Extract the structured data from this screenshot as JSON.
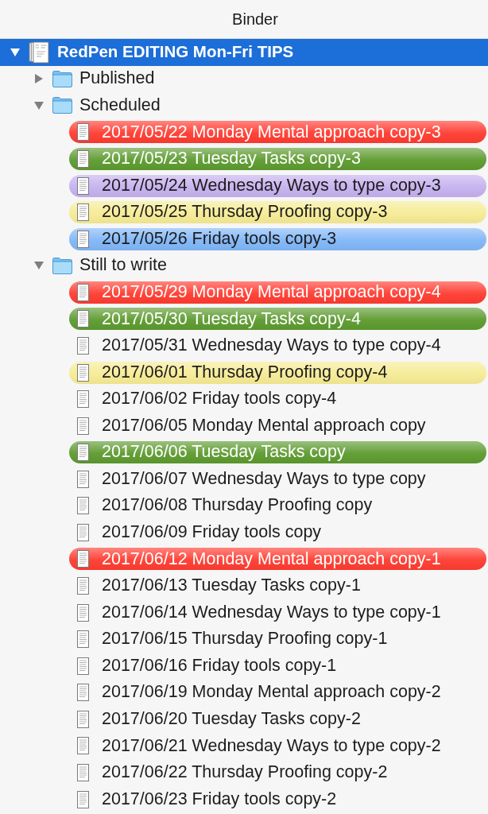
{
  "panel": {
    "title": "Binder"
  },
  "tree": [
    {
      "label": "RedPen EDITING Mon-Fri TIPS",
      "kind": "project",
      "selected": true,
      "expanded": true,
      "children": [
        {
          "label": "Published",
          "kind": "folder",
          "selected": false,
          "expanded": false
        },
        {
          "label": "Scheduled",
          "kind": "folder",
          "selected": false,
          "expanded": true,
          "children": [
            {
              "label": "2017/05/22 Monday Mental approach copy-3",
              "kind": "document",
              "selected": false,
              "color": "#ff3b30"
            },
            {
              "label": "2017/05/23 Tuesday Tasks copy-3",
              "kind": "document",
              "selected": false,
              "color": "#5c9a2e"
            },
            {
              "label": "2017/05/24 Wednesday Ways to type copy-3",
              "kind": "document",
              "selected": false,
              "color": "#c5b0ee"
            },
            {
              "label": "2017/05/25 Thursday Proofing copy-3",
              "kind": "document",
              "selected": false,
              "color": "#f6eb94"
            },
            {
              "label": "2017/05/26 Friday tools copy-3",
              "kind": "document",
              "selected": false,
              "color": "#80b6f7"
            }
          ]
        },
        {
          "label": "Still to write",
          "kind": "folder",
          "selected": false,
          "expanded": true,
          "children": [
            {
              "label": "2017/05/29 Monday Mental approach copy-4",
              "kind": "document",
              "selected": false,
              "color": "#ff3b30"
            },
            {
              "label": "2017/05/30 Tuesday Tasks copy-4",
              "kind": "document",
              "selected": false,
              "color": "#5c9a2e"
            },
            {
              "label": "2017/05/31 Wednesday Ways to type copy-4",
              "kind": "document",
              "selected": false
            },
            {
              "label": "2017/06/01 Thursday Proofing copy-4",
              "kind": "document",
              "selected": false,
              "color": "#f6eb94"
            },
            {
              "label": "2017/06/02 Friday tools copy-4",
              "kind": "document",
              "selected": false
            },
            {
              "label": "2017/06/05 Monday Mental approach copy",
              "kind": "document",
              "selected": false
            },
            {
              "label": "2017/06/06 Tuesday Tasks copy",
              "kind": "document",
              "selected": false,
              "color": "#5c9a2e"
            },
            {
              "label": "2017/06/07 Wednesday Ways to type copy",
              "kind": "document",
              "selected": false
            },
            {
              "label": "2017/06/08 Thursday Proofing copy",
              "kind": "document",
              "selected": false
            },
            {
              "label": "2017/06/09 Friday tools copy",
              "kind": "document",
              "selected": false
            },
            {
              "label": "2017/06/12 Monday Mental approach copy-1",
              "kind": "document",
              "selected": false,
              "color": "#ff3b30"
            },
            {
              "label": "2017/06/13 Tuesday Tasks copy-1",
              "kind": "document",
              "selected": false
            },
            {
              "label": "2017/06/14 Wednesday Ways to type copy-1",
              "kind": "document",
              "selected": false
            },
            {
              "label": "2017/06/15 Thursday Proofing copy-1",
              "kind": "document",
              "selected": false
            },
            {
              "label": "2017/06/16 Friday tools copy-1",
              "kind": "document",
              "selected": false
            },
            {
              "label": "2017/06/19 Monday Mental approach copy-2",
              "kind": "document",
              "selected": false
            },
            {
              "label": "2017/06/20 Tuesday Tasks copy-2",
              "kind": "document",
              "selected": false
            },
            {
              "label": "2017/06/21 Wednesday Ways to type copy-2",
              "kind": "document",
              "selected": false
            },
            {
              "label": "2017/06/22 Thursday Proofing copy-2",
              "kind": "document",
              "selected": false
            },
            {
              "label": "2017/06/23 Friday tools copy-2",
              "kind": "document",
              "selected": false
            }
          ]
        }
      ]
    }
  ]
}
